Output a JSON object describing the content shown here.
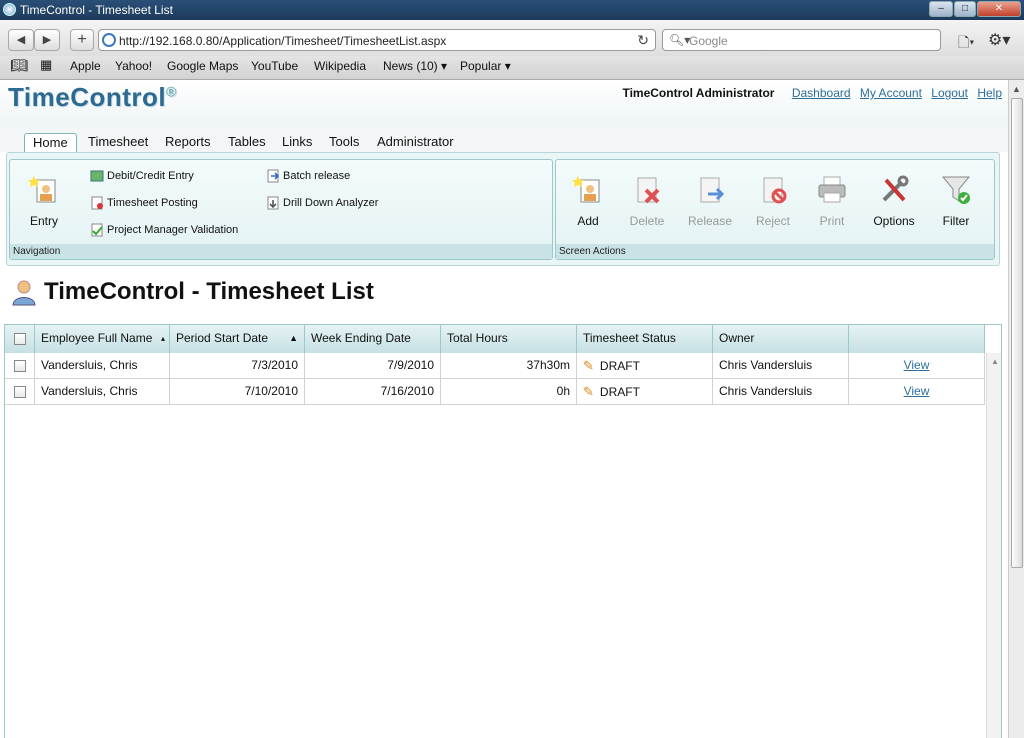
{
  "window": {
    "title": "TimeControl - Timesheet List"
  },
  "browser": {
    "url": "http://192.168.0.80/Application/Timesheet/TimesheetList.aspx",
    "search_placeholder": "Google",
    "bookmarks": [
      "Apple",
      "Yahoo!",
      "Google Maps",
      "YouTube",
      "Wikipedia",
      "News (10) ▾",
      "Popular ▾"
    ]
  },
  "app": {
    "logo_text": "TimeControl",
    "logo_mark": "®",
    "user": "TimeControl Administrator",
    "header_links": [
      "Dashboard",
      "My Account",
      "Logout",
      "Help"
    ],
    "menu_tabs": [
      "Home",
      "Timesheet",
      "Reports",
      "Tables",
      "Links",
      "Tools",
      "Administrator"
    ],
    "navigation": {
      "label": "Navigation",
      "entry_label": "Entry",
      "items": [
        "Debit/Credit Entry",
        "Timesheet Posting",
        "Project Manager Validation",
        "Batch release",
        "Drill Down Analyzer"
      ]
    },
    "screen_actions": {
      "label": "Screen Actions",
      "buttons": [
        "Add",
        "Delete",
        "Release",
        "Reject",
        "Print",
        "Options",
        "Filter"
      ]
    },
    "page_title": "TimeControl - Timesheet List"
  },
  "grid": {
    "columns": [
      "Employee Full Name",
      "Period Start Date",
      "Week Ending Date",
      "Total Hours",
      "Timesheet Status",
      "Owner"
    ],
    "rows": [
      {
        "employee": "Vandersluis, Chris",
        "start": "7/3/2010",
        "end": "7/9/2010",
        "hours": "37h30m",
        "status": "DRAFT",
        "owner": "Chris Vandersluis",
        "action": "View"
      },
      {
        "employee": "Vandersluis, Chris",
        "start": "7/10/2010",
        "end": "7/16/2010",
        "hours": "0h",
        "status": "DRAFT",
        "owner": "Chris Vandersluis",
        "action": "View"
      }
    ]
  }
}
